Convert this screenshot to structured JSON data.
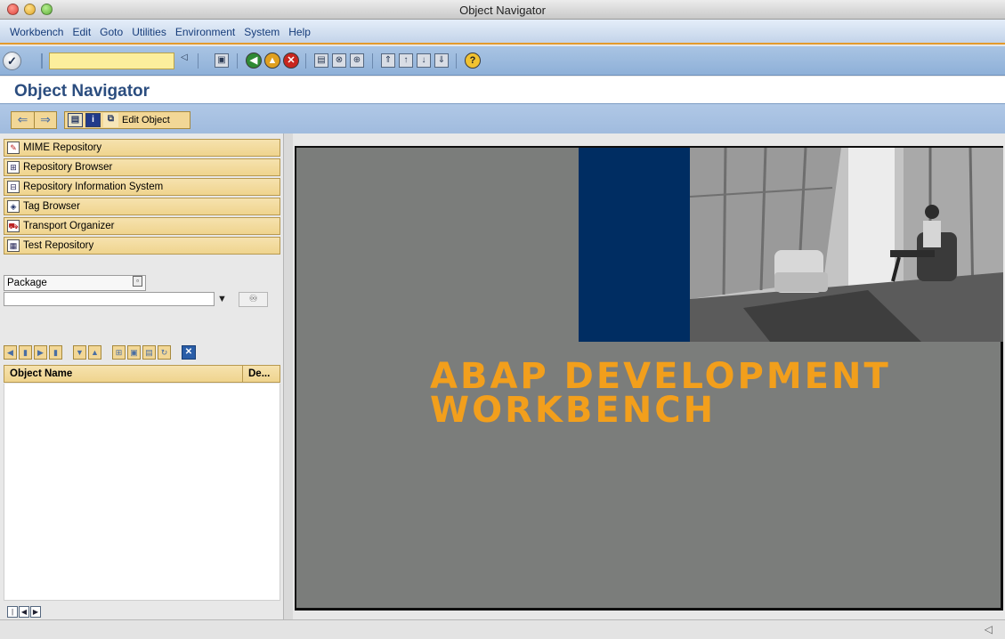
{
  "window": {
    "title": "Object Navigator"
  },
  "menubar": {
    "items": [
      "Workbench",
      "Edit",
      "Goto",
      "Utilities",
      "Environment",
      "System",
      "Help"
    ]
  },
  "toolbar": {
    "command_field_value": ""
  },
  "page": {
    "title": "Object Navigator"
  },
  "app_toolbar": {
    "edit_object_label": "Edit Object"
  },
  "repositories": [
    {
      "label": "MIME Repository",
      "icon": "pencil-document-icon"
    },
    {
      "label": "Repository Browser",
      "icon": "hierarchy-icon"
    },
    {
      "label": "Repository Information System",
      "icon": "tree-search-icon"
    },
    {
      "label": "Tag Browser",
      "icon": "tag-icon"
    },
    {
      "label": "Transport Organizer",
      "icon": "truck-icon"
    },
    {
      "label": "Test Repository",
      "icon": "test-table-icon"
    }
  ],
  "package": {
    "select_label": "Package",
    "input_value": ""
  },
  "object_table": {
    "columns": [
      "Object Name",
      "De..."
    ],
    "rows": []
  },
  "splash": {
    "title": "ABAP DEVELOPMENT\nWORKBENCH"
  },
  "colors": {
    "menu_accent": "#e39a2b",
    "splash_title": "#f29f1c",
    "splash_blue": "#002d62",
    "splash_gray": "#7b7d7b",
    "toolbar_blue": "#a0bbde",
    "tab_gold": "#efd48e"
  }
}
